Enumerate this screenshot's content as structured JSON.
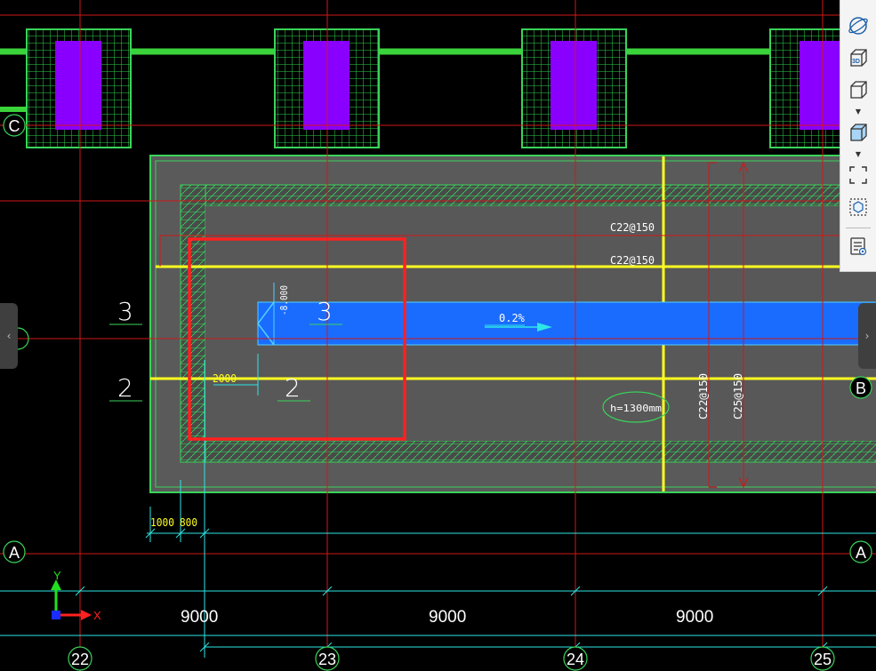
{
  "drawing": {
    "grid_cols": [
      "22",
      "23",
      "24",
      "25"
    ],
    "grid_rows": [
      "C",
      "B",
      "A"
    ],
    "dim_spans": [
      "9000",
      "9000",
      "9000"
    ],
    "dim_small": [
      "1000",
      "800"
    ],
    "dim_2000": "2000",
    "rebar_top_1": "C22@150",
    "rebar_top_2": "C22@150",
    "rebar_vert_1": "C22@150",
    "rebar_vert_2": "C25@150",
    "slope": "0.2%",
    "elevation": "-8.000",
    "height_note": "h=1300mm",
    "section_3_left": "3",
    "section_3_right": "3",
    "section_2_left": "2",
    "section_2_right": "2",
    "axis_x": "X",
    "axis_y": "Y"
  },
  "toolbar": {
    "icons": [
      "orbit-icon",
      "3d-view-icon",
      "cube-wireframe-icon",
      "cube-solid-icon",
      "fullscreen-icon",
      "view-box-icon",
      "properties-panel-icon"
    ]
  },
  "nav": {
    "left_arrow": "‹",
    "right_arrow": "›"
  },
  "colors": {
    "background": "#000000",
    "grid_line": "#d01818",
    "slab_fill": "#5a5a5a",
    "footing": "#3ad35a",
    "column": "#8a00ff",
    "channel": "#1a6cff",
    "highlight": "#ff2020",
    "dimension": "#2ee6e6",
    "yellow_line": "#ffff20"
  }
}
